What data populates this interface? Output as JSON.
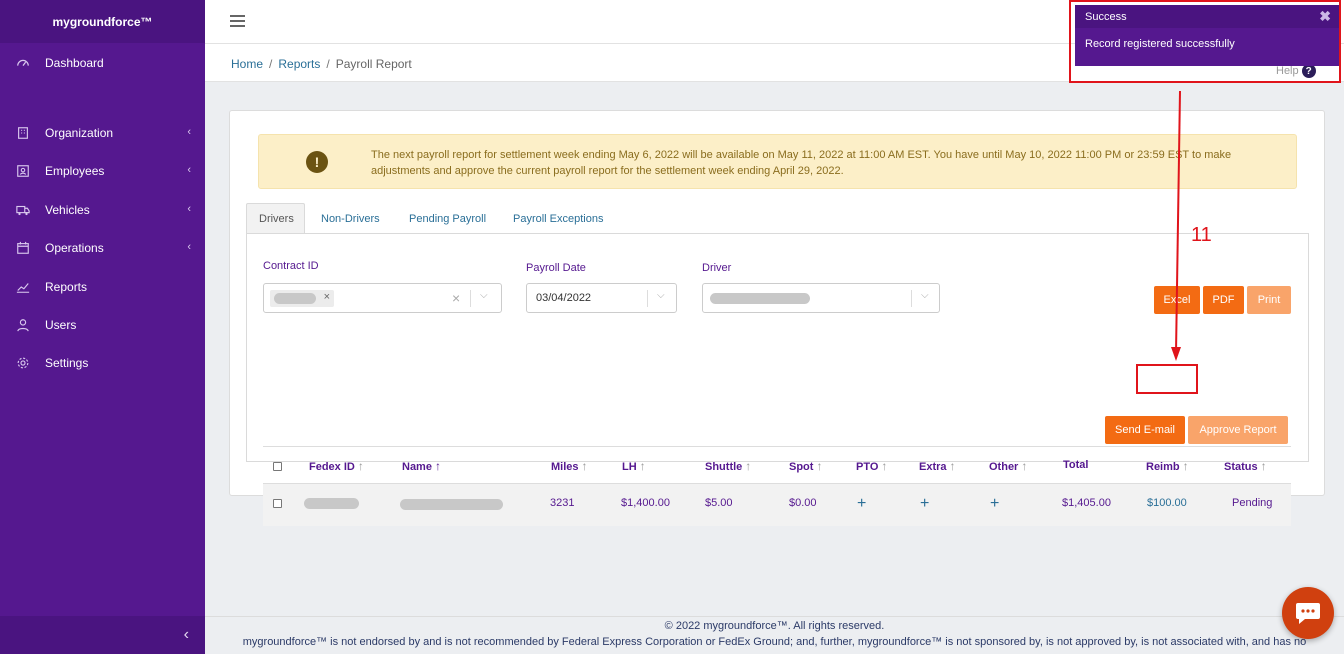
{
  "brand": "mygroundforce™",
  "sidebar": {
    "items": [
      {
        "label": "Dashboard",
        "icon": "dashboard-icon"
      },
      {
        "label": "Organization",
        "icon": "organization-icon"
      },
      {
        "label": "Employees",
        "icon": "employees-icon"
      },
      {
        "label": "Vehicles",
        "icon": "truck-icon"
      },
      {
        "label": "Operations",
        "icon": "calendar-icon"
      },
      {
        "label": "Reports",
        "icon": "chart-line-icon"
      },
      {
        "label": "Users",
        "icon": "users-icon"
      },
      {
        "label": "Settings",
        "icon": "gear-icon"
      }
    ]
  },
  "breadcrumb": {
    "home": "Home",
    "reports": "Reports",
    "current": "Payroll Report",
    "separator": "/"
  },
  "help": {
    "label": "Help",
    "icon_glyph": "?"
  },
  "alert": {
    "icon_glyph": "!",
    "text": "The next payroll report for settlement week ending May 6, 2022 will be available on May 11, 2022 at 11:00 AM EST. You have until May 10, 2022 11:00 PM or 23:59 EST to make adjustments and approve the current payroll report for the settlement week ending April 29, 2022."
  },
  "tabs": [
    "Drivers",
    "Non-Drivers",
    "Pending Payroll",
    "Payroll Exceptions"
  ],
  "filters": {
    "contract_id_label": "Contract ID",
    "payroll_date_label": "Payroll Date",
    "payroll_date_value": "03/04/2022",
    "driver_label": "Driver"
  },
  "buttons": {
    "excel": "Excel",
    "pdf": "PDF",
    "print": "Print",
    "send_email": "Send E-mail",
    "approve": "Approve Report"
  },
  "table": {
    "headers": {
      "fedex_id": "Fedex ID",
      "name": "Name",
      "miles": "Miles",
      "lh": "LH",
      "shuttle": "Shuttle",
      "spot": "Spot",
      "pto": "PTO",
      "extra": "Extra",
      "other": "Other",
      "total": "Total",
      "reimb": "Reimb",
      "status": "Status"
    },
    "row": {
      "miles": "3231",
      "lh": "$1,400.00",
      "shuttle": "$5.00",
      "spot": "$0.00",
      "total": "$1,405.00",
      "reimb": "$100.00",
      "status": "Pending"
    }
  },
  "toast": {
    "title": "Success",
    "message": "Record registered successfully"
  },
  "annotation": {
    "number": "11"
  },
  "footer": {
    "copyright": "© 2022 mygroundforce™. All rights reserved.",
    "disclaimer": "mygroundforce™ is not endorsed by and is not recommended by Federal Express Corporation or FedEx Ground; and, further, mygroundforce™ is not sponsored by, is not approved by, is not associated with, and has no"
  },
  "colors": {
    "sidebar": "#55188f",
    "accent_orange": "#f36b13",
    "annotation_red": "#e0141b",
    "link": "#2a6f97"
  }
}
